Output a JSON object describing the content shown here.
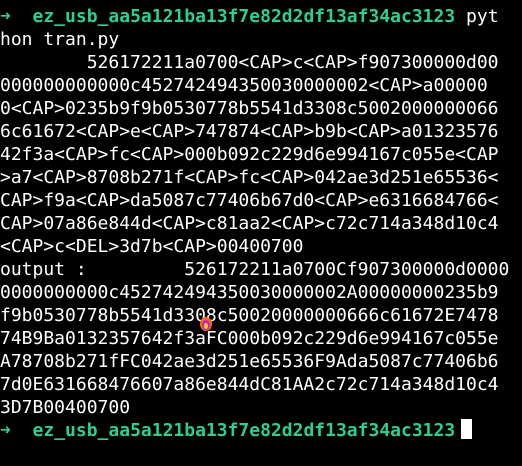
{
  "prompt": {
    "arrow": "➜",
    "directory": "ez_usb_aa5a121ba13f7e82d2df13af34ac3123",
    "command_first": "pyt",
    "command_rest": "hon tran.py"
  },
  "output_lines": [
    "        526172211a0700<CAP>c<CAP>f907300000d00",
    "000000000000c452742494350030000002<CAP>a00000",
    "0<CAP>0235b9f9b0530778b5541d3308c5002000000066",
    "6c61672<CAP>e<CAP>747874<CAP>b9b<CAP>a01323576",
    "42f3a<CAP>fc<CAP>000b092c229d6e994167c055e<CAP",
    ">a7<CAP>8708b271f<CAP>fc<CAP>042ae3d251e65536<",
    "CAP>f9a<CAP>da5087c77406b67d0<CAP>e6316684766<",
    "CAP>07a86e844d<CAP>c81aa2<CAP>c72c714a348d10c4",
    "<CAP>c<DEL>3d7b<CAP>00400700",
    "output :         526172211a0700Cf907300000d0000",
    "0000000000c452742494350030000002A00000000235b9",
    "f9b0530778b5541d3308c50020000000666c61672E7478",
    "74B9Ba0132357642f3aFC000b092c229d6e994167c055e",
    "A78708b271fFC042ae3d251e65536F9Ada5087c77406b6",
    "7d0E631668476607a86e844dC81AA2c72c714a348d10c4",
    "3D7B00400700"
  ],
  "final_prompt": {
    "arrow": "➜",
    "directory": "ez_usb_aa5a121ba13f7e82d2df13af34ac3123"
  },
  "colors": {
    "background": "#000000",
    "foreground": "#ffffff",
    "prompt_green": "#2bd08f"
  }
}
